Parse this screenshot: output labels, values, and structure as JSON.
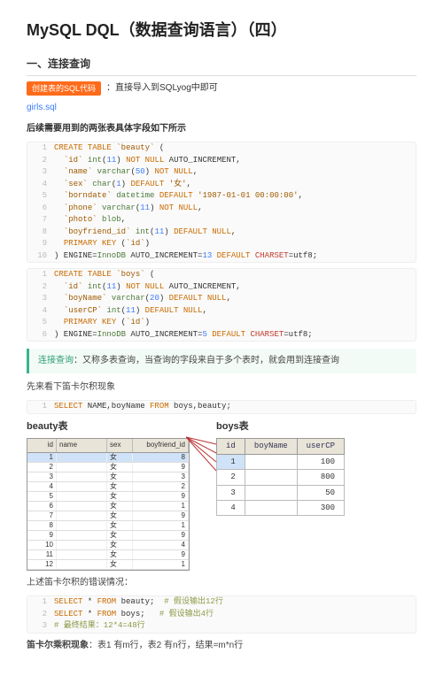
{
  "title": "MySQL DQL（数据查询语言）（四）",
  "section1": "一、连接查询",
  "tagline": {
    "tag": "创建表的SQL代码",
    "rest": "：直接导入到SQLyog中即可"
  },
  "file": "girls.sql",
  "note1": "后续需要用到的两张表具体字段如下所示",
  "code1": [
    {
      "n": "1",
      "h": "<span class='kw'>CREATE TABLE</span> <span class='str'>`beauty`</span> ("
    },
    {
      "n": "2",
      "h": "  <span class='str'>`id`</span> <span class='id2'>int</span>(<span class='pf'>11</span>) <span class='kw'>NOT NULL</span> AUTO_INCREMENT,"
    },
    {
      "n": "3",
      "h": "  <span class='str'>`name`</span> <span class='id2'>varchar</span>(<span class='pf'>50</span>) <span class='kw'>NOT NULL</span>,"
    },
    {
      "n": "4",
      "h": "  <span class='str'>`sex`</span> <span class='id2'>char</span>(<span class='pf'>1</span>) <span class='kw'>DEFAULT</span> <span class='str'>'女'</span>,"
    },
    {
      "n": "5",
      "h": "  <span class='str'>`borndate`</span> <span class='id2'>datetime</span> <span class='kw'>DEFAULT</span> <span class='str'>'1987-01-01 00:00:00'</span>,"
    },
    {
      "n": "6",
      "h": "  <span class='str'>`phone`</span> <span class='id2'>varchar</span>(<span class='pf'>11</span>) <span class='kw'>NOT NULL</span>,"
    },
    {
      "n": "7",
      "h": "  <span class='str'>`photo`</span> <span class='id2'>blob</span>,"
    },
    {
      "n": "8",
      "h": "  <span class='str'>`boyfriend_id`</span> <span class='id2'>int</span>(<span class='pf'>11</span>) <span class='kw'>DEFAULT NULL</span>,"
    },
    {
      "n": "9",
      "h": "  <span class='kw'>PRIMARY KEY</span> (<span class='str'>`id`</span>)"
    },
    {
      "n": "10",
      "h": ") ENGINE=<span class='id2'>InnoDB</span> AUTO_INCREMENT=<span class='pf'>13</span> <span class='kw'>DEFAULT</span> <span class='red'>CHARSET</span>=utf8;"
    }
  ],
  "code2": [
    {
      "n": "1",
      "h": "<span class='kw'>CREATE TABLE</span> <span class='str'>`boys`</span> ("
    },
    {
      "n": "2",
      "h": "  <span class='str'>`id`</span> <span class='id2'>int</span>(<span class='pf'>11</span>) <span class='kw'>NOT NULL</span> AUTO_INCREMENT,"
    },
    {
      "n": "3",
      "h": "  <span class='str'>`boyName`</span> <span class='id2'>varchar</span>(<span class='pf'>20</span>) <span class='kw'>DEFAULT NULL</span>,"
    },
    {
      "n": "4",
      "h": "  <span class='str'>`userCP`</span> <span class='id2'>int</span>(<span class='pf'>11</span>) <span class='kw'>DEFAULT NULL</span>,"
    },
    {
      "n": "5",
      "h": "  <span class='kw'>PRIMARY KEY</span> (<span class='str'>`id`</span>)"
    },
    {
      "n": "6",
      "h": ") ENGINE=<span class='id2'>InnoDB</span> AUTO_INCREMENT=<span class='pf'>5</span> <span class='kw'>DEFAULT</span> <span class='red'>CHARSET</span>=utf8;"
    }
  ],
  "callout": {
    "lead": "连接查询",
    "rest": "：又称多表查询，当查询的字段来自于多个表时，就会用到连接查询"
  },
  "plain1": "先来看下笛卡尔积现象",
  "code3": [
    {
      "n": "1",
      "h": "<span class='kw'>SELECT</span> NAME,boyName <span class='kw'>FROM</span> boys,beauty;"
    }
  ],
  "beauty": {
    "title": "beauty表",
    "headers": [
      "id",
      "name",
      "sex",
      "boyfriend_id"
    ],
    "rows": [
      [
        "1",
        "",
        "女",
        "8"
      ],
      [
        "2",
        "",
        "女",
        "9"
      ],
      [
        "3",
        "",
        "女",
        "3"
      ],
      [
        "4",
        "",
        "女",
        "2"
      ],
      [
        "5",
        "",
        "女",
        "9"
      ],
      [
        "6",
        "",
        "女",
        "1"
      ],
      [
        "7",
        "",
        "女",
        "9"
      ],
      [
        "8",
        "",
        "女",
        "1"
      ],
      [
        "9",
        "",
        "女",
        "9"
      ],
      [
        "10",
        "",
        "女",
        "4"
      ],
      [
        "11",
        "",
        "女",
        "9"
      ],
      [
        "12",
        "",
        "女",
        "1"
      ]
    ]
  },
  "boys": {
    "title": "boys表",
    "headers": [
      "id",
      "boyName",
      "userCP"
    ],
    "rows": [
      [
        "1",
        "",
        "100"
      ],
      [
        "2",
        "",
        "800"
      ],
      [
        "3",
        "",
        "50"
      ],
      [
        "4",
        "",
        "300"
      ]
    ]
  },
  "plain2": "上述笛卡尔积的错误情况：",
  "code4": [
    {
      "n": "1",
      "h": "<span class='kw'>SELECT</span> * <span class='kw'>FROM</span> beauty;  <span class='cmt'># 假设输出12行</span>"
    },
    {
      "n": "2",
      "h": "<span class='kw'>SELECT</span> * <span class='kw'>FROM</span> boys;   <span class='cmt'># 假设输出4行</span>"
    },
    {
      "n": "3",
      "h": "<span class='cmt'># 最终结果：12*4=48行</span>"
    }
  ],
  "plain3_lead": "笛卡尔乘积现象",
  "plain3_rest": "：表1 有m行，表2 有n行，结果=m*n行"
}
